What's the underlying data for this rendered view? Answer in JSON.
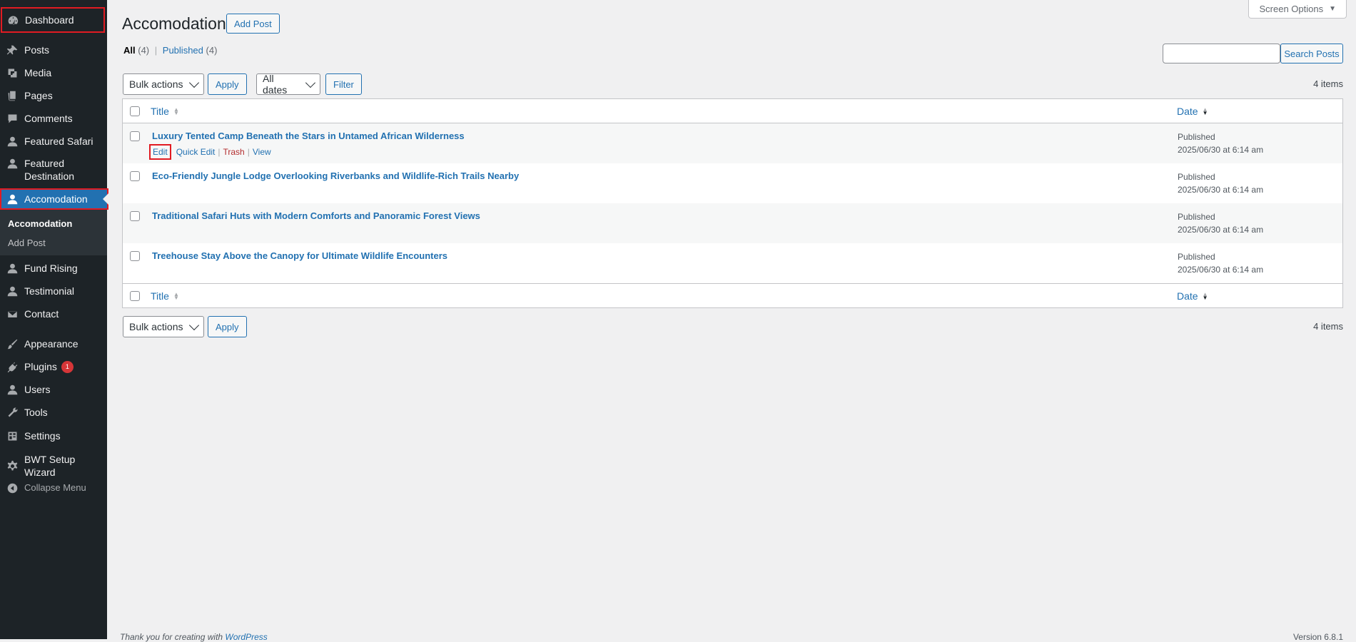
{
  "sidebar": {
    "items": [
      {
        "label": "Dashboard",
        "icon": "dashboard-icon"
      },
      {
        "label": "Posts",
        "icon": "pin-icon"
      },
      {
        "label": "Media",
        "icon": "media-icon"
      },
      {
        "label": "Pages",
        "icon": "pages-icon"
      },
      {
        "label": "Comments",
        "icon": "comments-icon"
      },
      {
        "label": "Featured Safari",
        "icon": "person-icon"
      },
      {
        "label": "Featured Destination",
        "icon": "person-icon"
      },
      {
        "label": "Accomodation",
        "icon": "person-icon"
      },
      {
        "label": "Fund Rising",
        "icon": "person-icon"
      },
      {
        "label": "Testimonial",
        "icon": "person-icon"
      },
      {
        "label": "Contact",
        "icon": "mail-icon"
      },
      {
        "label": "Appearance",
        "icon": "brush-icon"
      },
      {
        "label": "Plugins",
        "icon": "plugin-icon",
        "badge": "1"
      },
      {
        "label": "Users",
        "icon": "users-icon"
      },
      {
        "label": "Tools",
        "icon": "wrench-icon"
      },
      {
        "label": "Settings",
        "icon": "settings-icon"
      },
      {
        "label": "BWT Setup Wizard",
        "icon": "gear-icon"
      },
      {
        "label": "Collapse Menu",
        "icon": "collapse-icon"
      }
    ],
    "submenu": [
      {
        "label": "Accomodation"
      },
      {
        "label": "Add Post"
      }
    ]
  },
  "page": {
    "title": "Accomodation",
    "add_post_label": "Add Post",
    "screen_options_label": "Screen Options",
    "filters": {
      "all_label": "All",
      "all_count": "(4)",
      "published_label": "Published",
      "published_count": "(4)"
    },
    "search_button_label": "Search Posts",
    "search_value": "",
    "bulk_actions_label": "Bulk actions",
    "apply_label": "Apply",
    "all_dates_label": "All dates",
    "filter_label": "Filter",
    "items_count": "4 items"
  },
  "table": {
    "columns": {
      "title": "Title",
      "date": "Date"
    },
    "rows": [
      {
        "title": "Luxury Tented Camp Beneath the Stars in Untamed African Wilderness",
        "status": "Published",
        "date": "2025/06/30 at 6:14 am"
      },
      {
        "title": "Eco-Friendly Jungle Lodge Overlooking Riverbanks and Wildlife-Rich Trails Nearby",
        "status": "Published",
        "date": "2025/06/30 at 6:14 am"
      },
      {
        "title": "Traditional Safari Huts with Modern Comforts and Panoramic Forest Views",
        "status": "Published",
        "date": "2025/06/30 at 6:14 am"
      },
      {
        "title": "Treehouse Stay Above the Canopy for Ultimate Wildlife Encounters",
        "status": "Published",
        "date": "2025/06/30 at 6:14 am"
      }
    ],
    "row_actions": {
      "edit": "Edit",
      "quick_edit": "Quick Edit",
      "trash": "Trash",
      "view": "View"
    }
  },
  "footer": {
    "thanks_prefix": "Thank you for creating with ",
    "thanks_link": "WordPress",
    "version": "Version 6.8.1"
  }
}
